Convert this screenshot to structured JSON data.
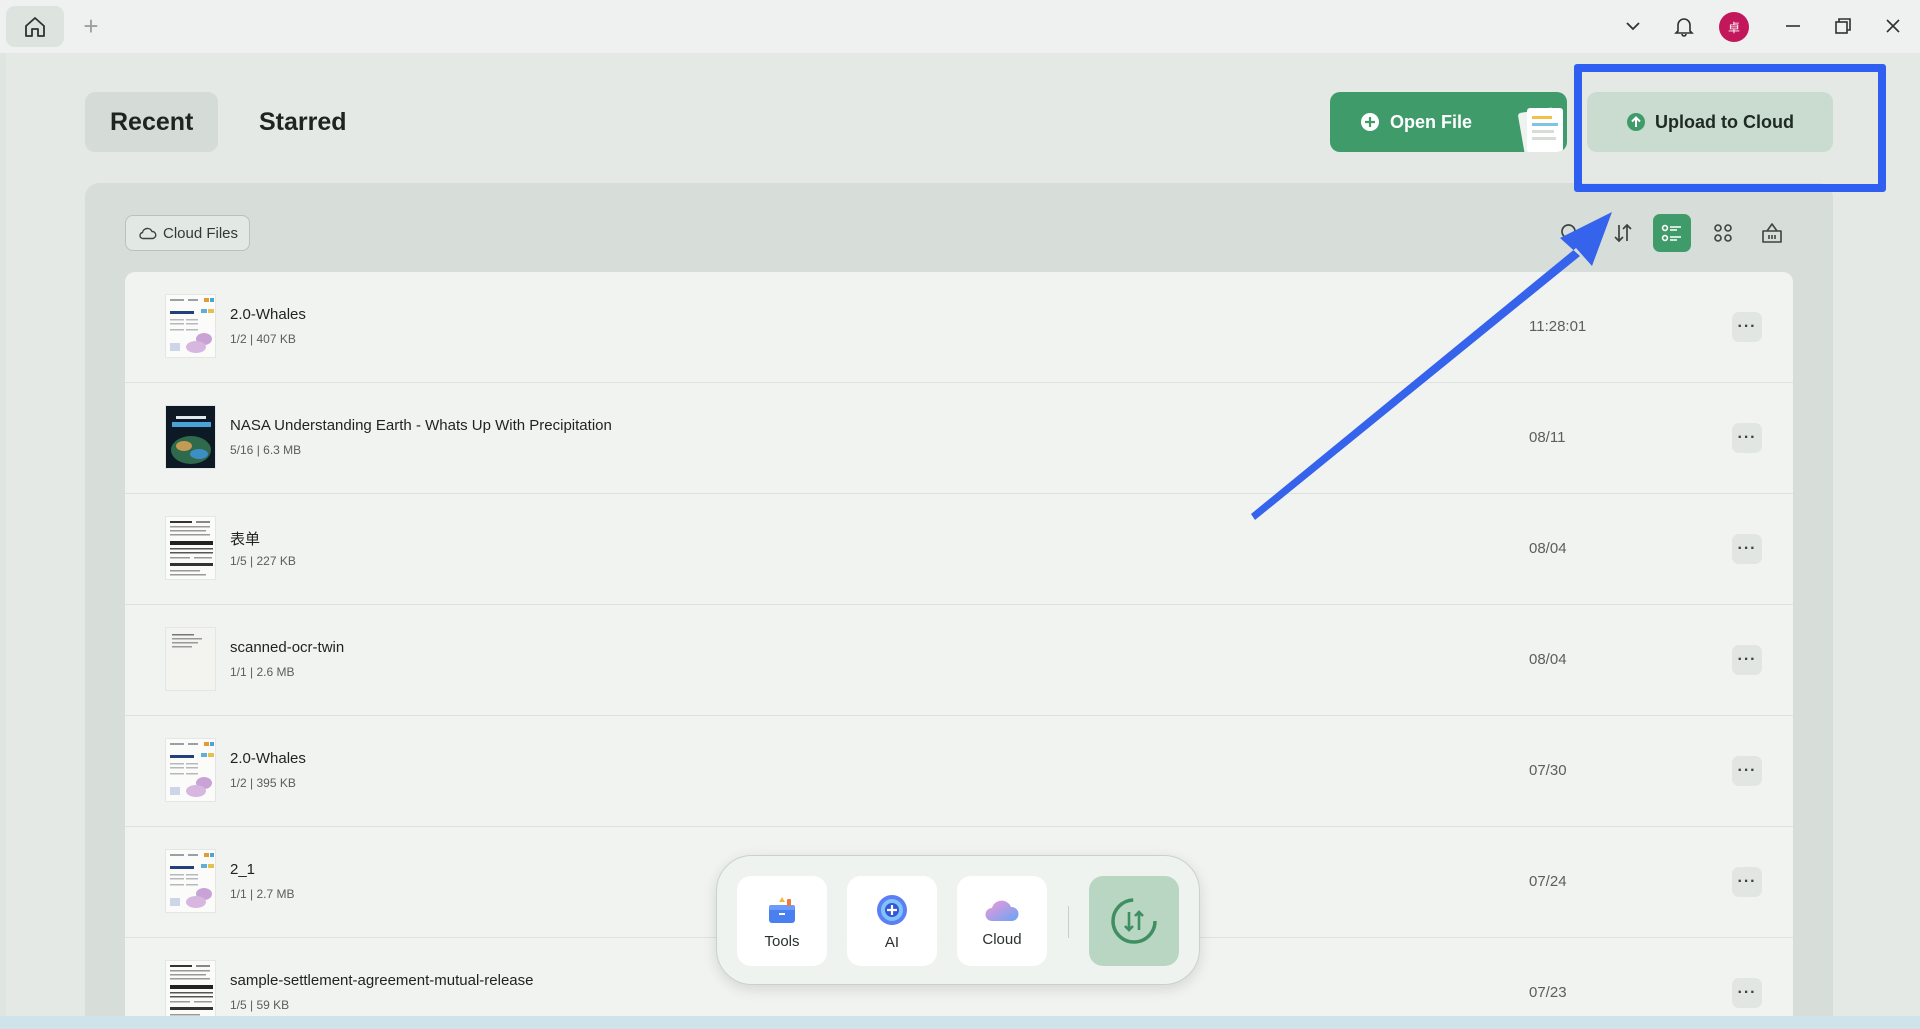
{
  "tabs": {
    "recent": "Recent",
    "starred": "Starred"
  },
  "actions": {
    "open_file": "Open File",
    "upload_to_cloud": "Upload to Cloud"
  },
  "toolbar": {
    "cloud_files": "Cloud Files"
  },
  "user": {
    "avatar_text": "卓"
  },
  "files": [
    {
      "name": "2.0-Whales",
      "meta": "1/2 | 407 KB",
      "date": "11:28:01",
      "thumb": "whales"
    },
    {
      "name": "NASA Understanding Earth - Whats Up With Precipitation",
      "meta": "5/16 | 6.3 MB",
      "date": "08/11",
      "thumb": "nasa"
    },
    {
      "name": "表单",
      "meta": "1/5 | 227 KB",
      "date": "08/04",
      "thumb": "form"
    },
    {
      "name": "scanned-ocr-twin",
      "meta": "1/1 | 2.6 MB",
      "date": "08/04",
      "thumb": "scan"
    },
    {
      "name": "2.0-Whales",
      "meta": "1/2 | 395 KB",
      "date": "07/30",
      "thumb": "whales"
    },
    {
      "name": "2_1",
      "meta": "1/1 | 2.7 MB",
      "date": "07/24",
      "thumb": "whales"
    },
    {
      "name": "sample-settlement-agreement-mutual-release",
      "meta": "1/5 | 59 KB",
      "date": "07/23",
      "thumb": "form"
    }
  ],
  "dock": {
    "tools": "Tools",
    "ai": "AI",
    "cloud": "Cloud"
  },
  "colors": {
    "accent": "#3f9c6a",
    "highlight": "#2f5ff0",
    "avatar": "#c2185b"
  },
  "icons": [
    "home-icon",
    "plus-icon",
    "chevron-down-icon",
    "bell-icon",
    "minimize-icon",
    "restore-icon",
    "close-icon",
    "plus-circle-icon",
    "upload-icon",
    "cloud-icon",
    "search-icon",
    "sort-icon",
    "list-view-icon",
    "grid-view-icon",
    "basket-icon",
    "more-icon",
    "tools-icon",
    "ai-icon",
    "sync-icon"
  ]
}
